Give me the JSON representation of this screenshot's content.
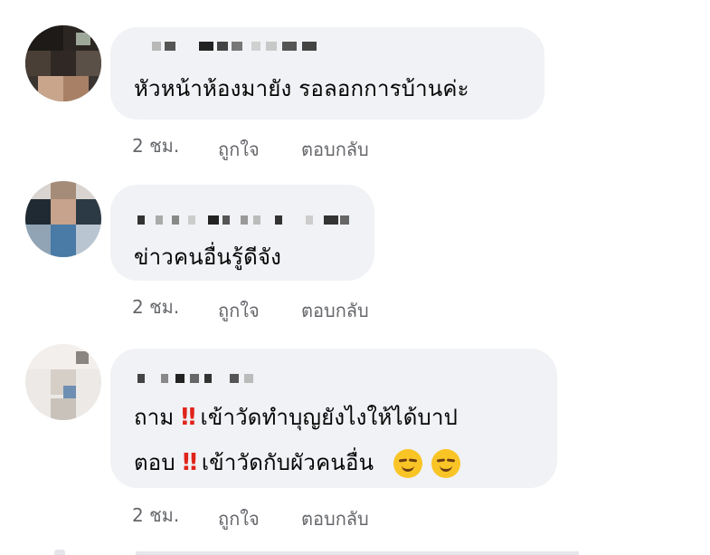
{
  "comments": [
    {
      "text_lines": [
        "หัวหน้าห้องมายัง รอลอกการบ้านค่ะ"
      ],
      "time": "2 ชม.",
      "like_label": "ถูกใจ",
      "reply_label": "ตอบกลับ"
    },
    {
      "text_lines": [
        "ข่าวคนอื่นรู้ดีจัง"
      ],
      "time": "2 ชม.",
      "like_label": "ถูกใจ",
      "reply_label": "ตอบกลับ"
    },
    {
      "line1_prefix": "ถาม",
      "line1_bang": "‼",
      "line1_suffix": "เข้าวัดทำบุญยังไงให้ได้บาป",
      "line2_prefix": "ตอบ",
      "line2_bang": "‼",
      "line2_suffix": "เข้าวัดกับผัวคนอื่น",
      "emojis": [
        "smirking-face",
        "smirking-face"
      ],
      "time": "2 ชม.",
      "like_label": "ถูกใจ",
      "reply_label": "ตอบกลับ"
    }
  ],
  "colors": {
    "bubble": "#f0f2f5",
    "text": "#050505",
    "meta": "#65676b",
    "bang": "#e0241b"
  }
}
